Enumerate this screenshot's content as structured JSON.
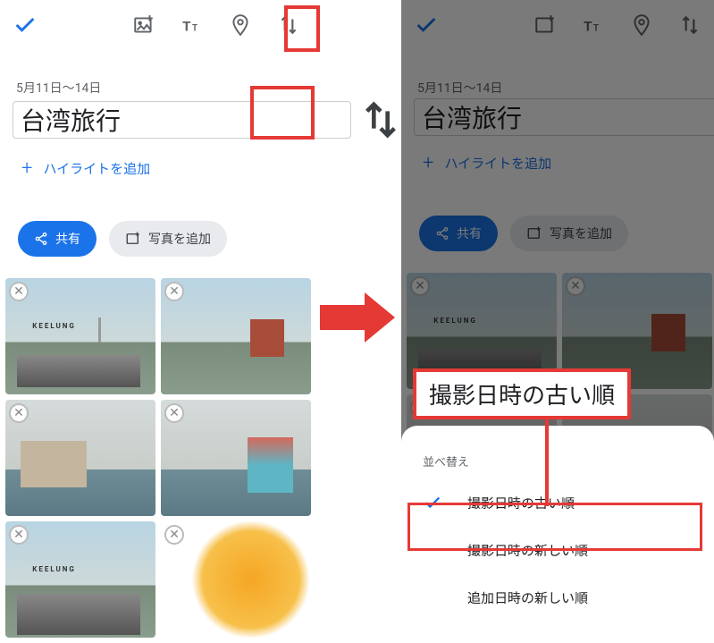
{
  "left": {
    "date_range": "5月11日〜14日",
    "album_title": "台湾旅行",
    "add_highlight": "ハイライトを追加",
    "share_label": "共有",
    "add_photo_label": "写真を追加"
  },
  "right": {
    "date_range": "5月11日〜14日",
    "album_title": "台湾旅行",
    "add_highlight": "ハイライトを追加",
    "share_label": "共有",
    "add_photo_label": "写真を追加",
    "sheet_title": "並べ替え",
    "sort_options": [
      {
        "label": "撮影日時の古い順",
        "selected": true
      },
      {
        "label": "撮影日時の新しい順",
        "selected": false
      },
      {
        "label": "追加日時の新しい順",
        "selected": false
      }
    ]
  },
  "callout_text": "撮影日時の古い順"
}
